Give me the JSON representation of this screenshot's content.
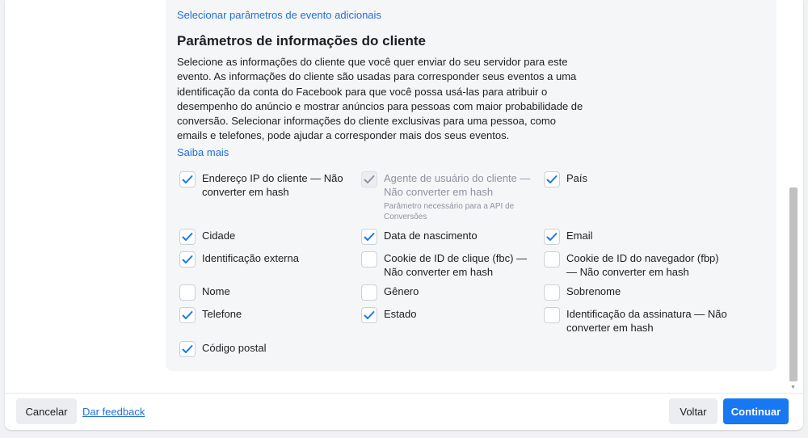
{
  "panel": {
    "top_link": "Selecionar parâmetros de evento adicionais",
    "title": "Parâmetros de informações do cliente",
    "description": "Selecione as informações do cliente que você quer enviar do seu servidor para este evento. As informações do cliente são usadas para corresponder seus eventos a uma identificação da conta do Facebook para que você possa usá-las para atribuir o desempenho do anúncio e mostrar anúncios para pessoas com maior probabilidade de conversão. Selecionar informações do cliente exclusivas para uma pessoa, como emails e telefones, pode ajudar a corresponder mais dos seus eventos.",
    "learn_more": "Saiba mais"
  },
  "options": [
    {
      "label": "Endereço IP do cliente — Não converter em hash",
      "checked": true,
      "disabled": false
    },
    {
      "label": "Agente de usuário do cliente — Não converter em hash",
      "checked": true,
      "disabled": true,
      "note": "Parâmetro necessário para a API de Conversões"
    },
    {
      "label": "País",
      "checked": true,
      "disabled": false
    },
    {
      "label": "Cidade",
      "checked": true,
      "disabled": false
    },
    {
      "label": "Data de nascimento",
      "checked": true,
      "disabled": false
    },
    {
      "label": "Email",
      "checked": true,
      "disabled": false
    },
    {
      "label": "Identificação externa",
      "checked": true,
      "disabled": false
    },
    {
      "label": "Cookie de ID de clique (fbc) — Não converter em hash",
      "checked": false,
      "disabled": false
    },
    {
      "label": "Cookie de ID do navegador (fbp) — Não converter em hash",
      "checked": false,
      "disabled": false
    },
    {
      "label": "Nome",
      "checked": false,
      "disabled": false
    },
    {
      "label": "Gênero",
      "checked": false,
      "disabled": false
    },
    {
      "label": "Sobrenome",
      "checked": false,
      "disabled": false
    },
    {
      "label": "Telefone",
      "checked": true,
      "disabled": false
    },
    {
      "label": "Estado",
      "checked": true,
      "disabled": false
    },
    {
      "label": "Identificação da assinatura — Não converter em hash",
      "checked": false,
      "disabled": false
    },
    {
      "label": "Código postal",
      "checked": true,
      "disabled": false
    }
  ],
  "footer": {
    "cancel": "Cancelar",
    "feedback": "Dar feedback",
    "back": "Voltar",
    "continue": "Continuar"
  },
  "colors": {
    "accent": "#1877f2",
    "link": "#216fdb",
    "check": "#1877f2",
    "check_disabled": "#8d949e"
  }
}
